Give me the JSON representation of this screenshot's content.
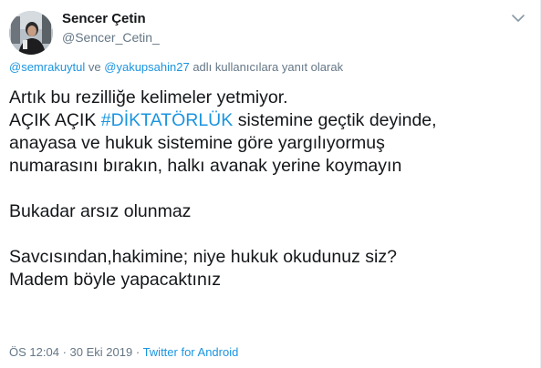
{
  "author": {
    "display_name": "Sencer Çetin",
    "screen_name": "@Sencer_Cetin_",
    "avatar_icon": "profile-photo"
  },
  "reply_context": {
    "mention_1": "@semrakuytul",
    "connector": "ve",
    "mention_2": "@yakupsahin27",
    "suffix": "adlı kullanıcılara yanıt olarak"
  },
  "tweet": {
    "line_1": "Artık bu rezilliğe kelimeler yetmiyor.",
    "line_2_before": "AÇIK AÇIK ",
    "hashtag": "#DİKTATÖRLÜK",
    "line_2_after": " sistemine geçtik deyinde,",
    "line_3": "anayasa ve hukuk sistemine göre yargılıyormuş",
    "line_4": "numarasını bırakın, halkı avanak yerine koymayın",
    "line_5": "Bukadar arsız olunmaz",
    "line_6": "Savcısından,hakimine; niye hukuk okudunuz siz?",
    "line_7": "Madem böyle yapacaktınız"
  },
  "meta": {
    "time": "ÖS 12:04",
    "separator_1": "·",
    "date": "30 Eki 2019",
    "separator_2": "·",
    "source": "Twitter for Android"
  },
  "colors": {
    "link": "#1b95e0",
    "muted": "#657786",
    "text": "#14171a"
  }
}
